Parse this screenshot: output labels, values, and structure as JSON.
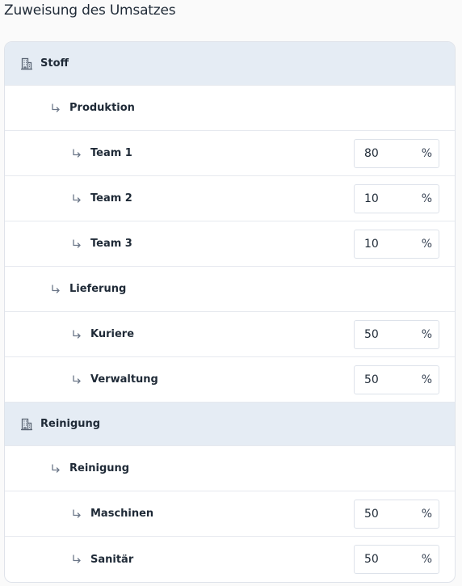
{
  "title": "Zuweisung des Umsatzes",
  "percent_symbol": "%",
  "rows": [
    {
      "label": "Stoff"
    },
    {
      "label": "Produktion"
    },
    {
      "label": "Team 1",
      "value": "80"
    },
    {
      "label": "Team 2",
      "value": "10"
    },
    {
      "label": "Team 3",
      "value": "10"
    },
    {
      "label": "Lieferung"
    },
    {
      "label": "Kuriere",
      "value": "50"
    },
    {
      "label": "Verwaltung",
      "value": "50"
    },
    {
      "label": "Reinigung"
    },
    {
      "label": "Reinigung"
    },
    {
      "label": "Maschinen",
      "value": "50"
    },
    {
      "label": "Sanitär",
      "value": "50"
    }
  ]
}
